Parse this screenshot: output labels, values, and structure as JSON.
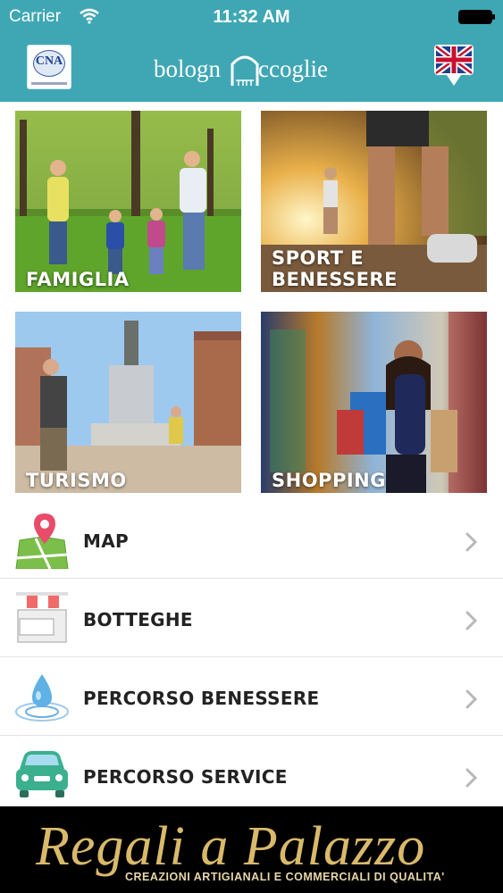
{
  "status_bar": {
    "carrier": "Carrier",
    "time": "11:32 AM",
    "wifi_icon": "wifi-icon",
    "battery_icon": "battery-icon"
  },
  "nav": {
    "left_logo_text": "CNA",
    "brand_left": "bologn",
    "brand_right": "ccoglie",
    "language_icon": "uk-flag-icon"
  },
  "tiles": [
    {
      "label_lines": [
        "FAMIGLIA"
      ],
      "image": "family-walking-in-park"
    },
    {
      "label_lines": [
        "SPORT E",
        "BENESSERE"
      ],
      "image": "runners-on-forest-trail"
    },
    {
      "label_lines": [
        "TURISMO"
      ],
      "image": "tourist-photographing-fountain"
    },
    {
      "label_lines": [
        "SHOPPING"
      ],
      "image": "woman-with-shopping-bags"
    }
  ],
  "menu": [
    {
      "label": "MAP",
      "icon": "map-pin-icon"
    },
    {
      "label": "BOTTEGHE",
      "icon": "shop-awning-icon"
    },
    {
      "label": "PERCORSO BENESSERE",
      "icon": "water-drop-icon"
    },
    {
      "label": "PERCORSO SERVICE",
      "icon": "car-icon"
    }
  ],
  "banner": {
    "title": "Regali a Palazzo",
    "subtitle": "CREAZIONI ARTIGIANALI E COMMERCIALI DI QUALITA'"
  },
  "colors": {
    "header_teal": "#3fa7b4",
    "banner_gold": "#d9b96a"
  }
}
